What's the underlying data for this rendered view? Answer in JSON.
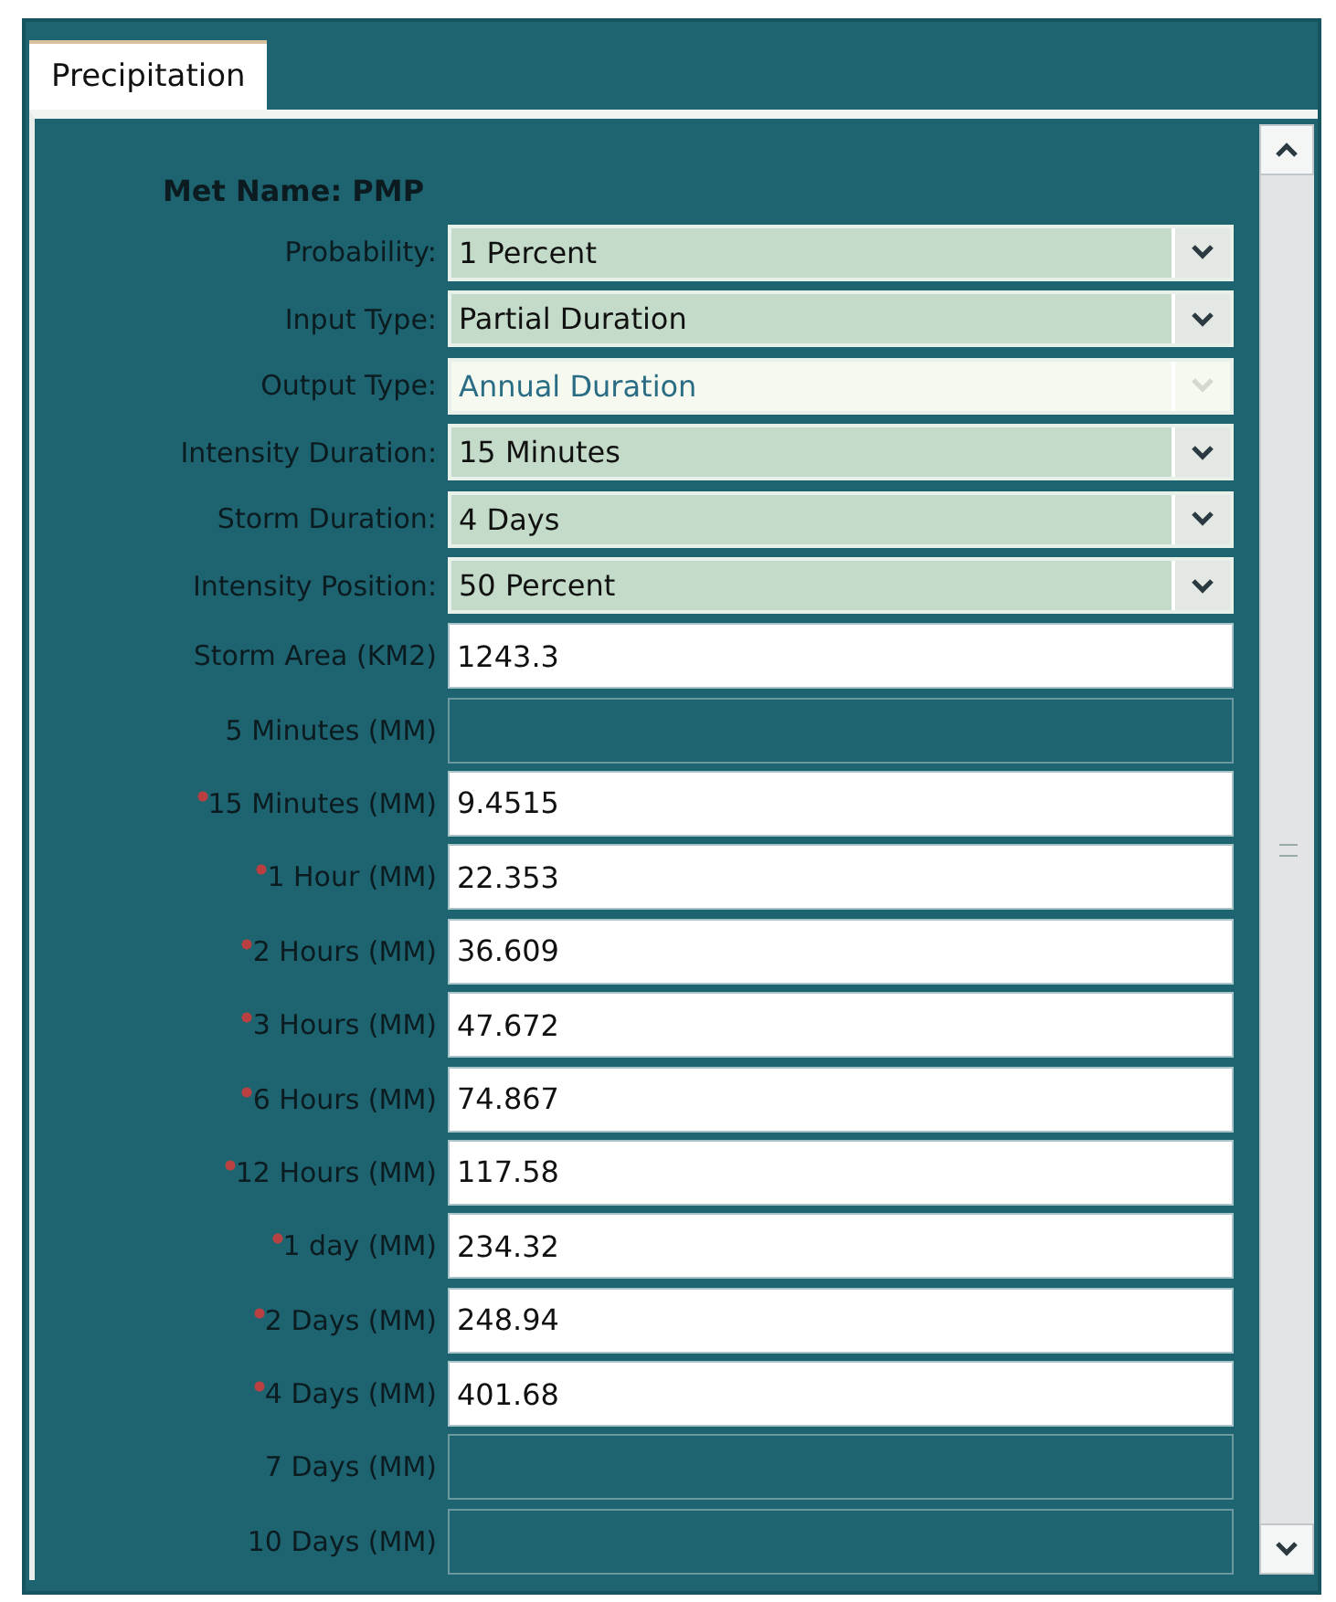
{
  "tabs": [
    {
      "label": "Precipitation",
      "selected": true
    }
  ],
  "met_name": "Met Name: PMP",
  "fields": [
    {
      "kind": "dropdown",
      "label": "Probability:",
      "value": "1 Percent",
      "disabled": false
    },
    {
      "kind": "dropdown",
      "label": "Input Type:",
      "value": "Partial Duration",
      "disabled": false
    },
    {
      "kind": "dropdown",
      "label": "Output Type:",
      "value": "Annual Duration",
      "disabled": true
    },
    {
      "kind": "dropdown",
      "label": "Intensity Duration:",
      "value": "15 Minutes",
      "disabled": false
    },
    {
      "kind": "dropdown",
      "label": "Storm Duration:",
      "value": "4 Days",
      "disabled": false
    },
    {
      "kind": "dropdown",
      "label": "Intensity Position:",
      "value": "50 Percent",
      "disabled": false
    },
    {
      "kind": "text",
      "label": "Storm Area (KM2)",
      "value": "1243.3",
      "required": false,
      "disabled": false
    },
    {
      "kind": "text",
      "label": "5 Minutes (MM)",
      "required": false,
      "disabled": true
    },
    {
      "kind": "text",
      "label": "15 Minutes (MM)",
      "value": "9.4515",
      "required": true,
      "disabled": false
    },
    {
      "kind": "text",
      "label": "1 Hour (MM)",
      "value": "22.353",
      "required": true,
      "disabled": false
    },
    {
      "kind": "text",
      "label": "2 Hours (MM)",
      "value": "36.609",
      "required": true,
      "disabled": false
    },
    {
      "kind": "text",
      "label": "3 Hours (MM)",
      "value": "47.672",
      "required": true,
      "disabled": false
    },
    {
      "kind": "text",
      "label": "6 Hours (MM)",
      "value": "74.867",
      "required": true,
      "disabled": false
    },
    {
      "kind": "text",
      "label": "12 Hours (MM)",
      "value": "117.58",
      "required": true,
      "disabled": false
    },
    {
      "kind": "text",
      "label": "1 day (MM)",
      "value": "234.32",
      "required": true,
      "disabled": false
    },
    {
      "kind": "text",
      "label": "2 Days (MM)",
      "value": "248.94",
      "required": true,
      "disabled": false
    },
    {
      "kind": "text",
      "label": "4 Days (MM)",
      "value": "401.68",
      "required": true,
      "disabled": false
    },
    {
      "kind": "text",
      "label": "7 Days (MM)",
      "required": false,
      "disabled": true
    },
    {
      "kind": "text",
      "label": "10 Days (MM)",
      "required": false,
      "disabled": true
    }
  ]
}
